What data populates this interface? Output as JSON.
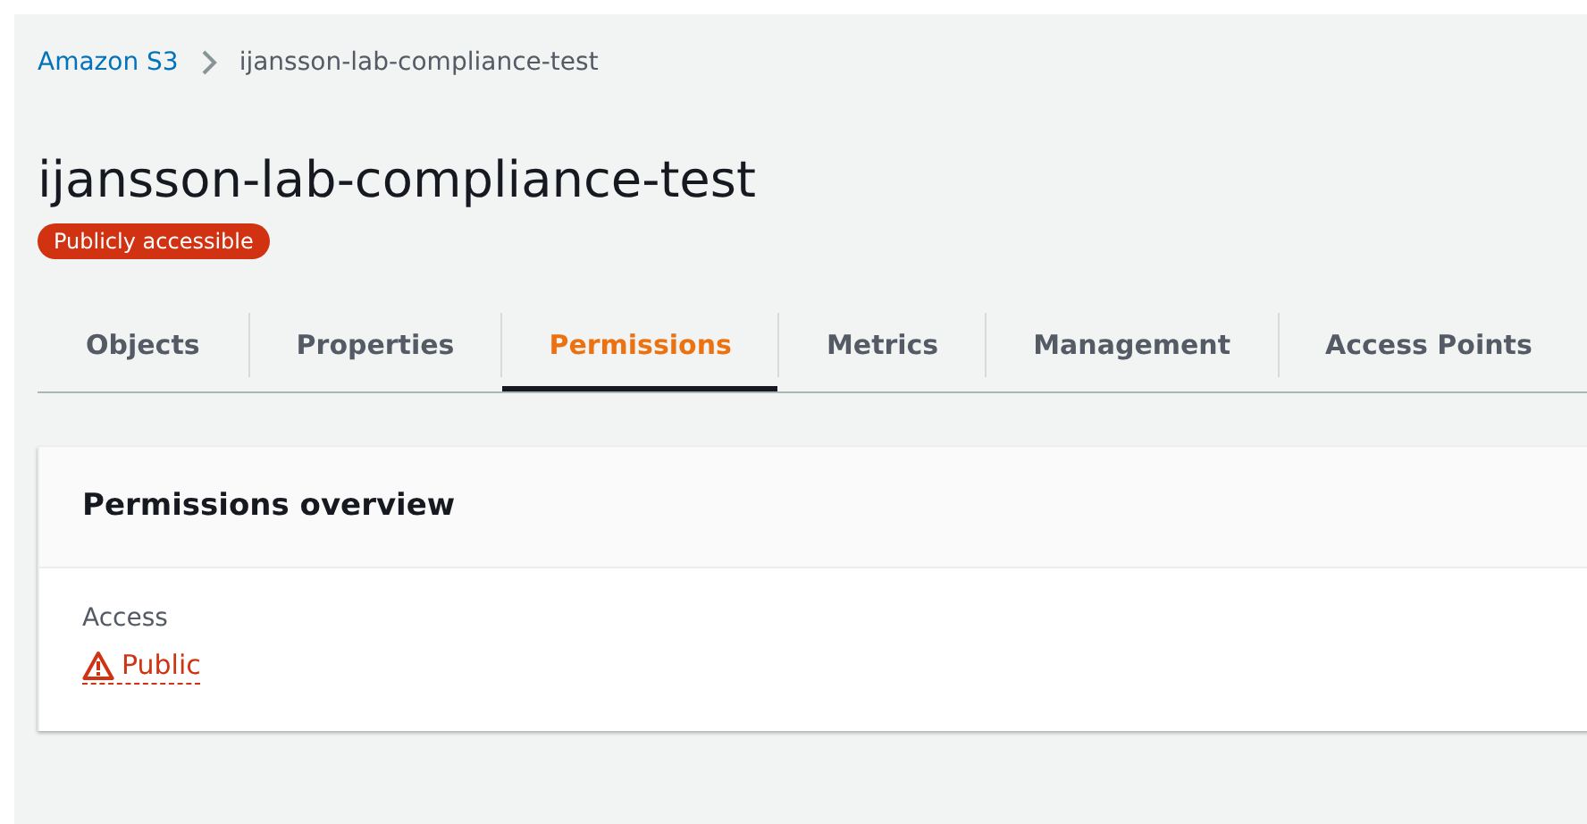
{
  "breadcrumbs": [
    {
      "label": "Amazon S3",
      "kind": "link"
    },
    {
      "label": "ijansson-lab-compliance-test",
      "kind": "current"
    }
  ],
  "title": "ijansson-lab-compliance-test",
  "badge": "Publicly accessible",
  "tabs": [
    {
      "label": "Objects",
      "selected": false
    },
    {
      "label": "Properties",
      "selected": false
    },
    {
      "label": "Permissions",
      "selected": true
    },
    {
      "label": "Metrics",
      "selected": false
    },
    {
      "label": "Management",
      "selected": false
    },
    {
      "label": "Access Points",
      "selected": false
    }
  ],
  "panel": {
    "title": "Permissions overview",
    "field_label": "Access",
    "field_value": "Public",
    "warning": true
  }
}
